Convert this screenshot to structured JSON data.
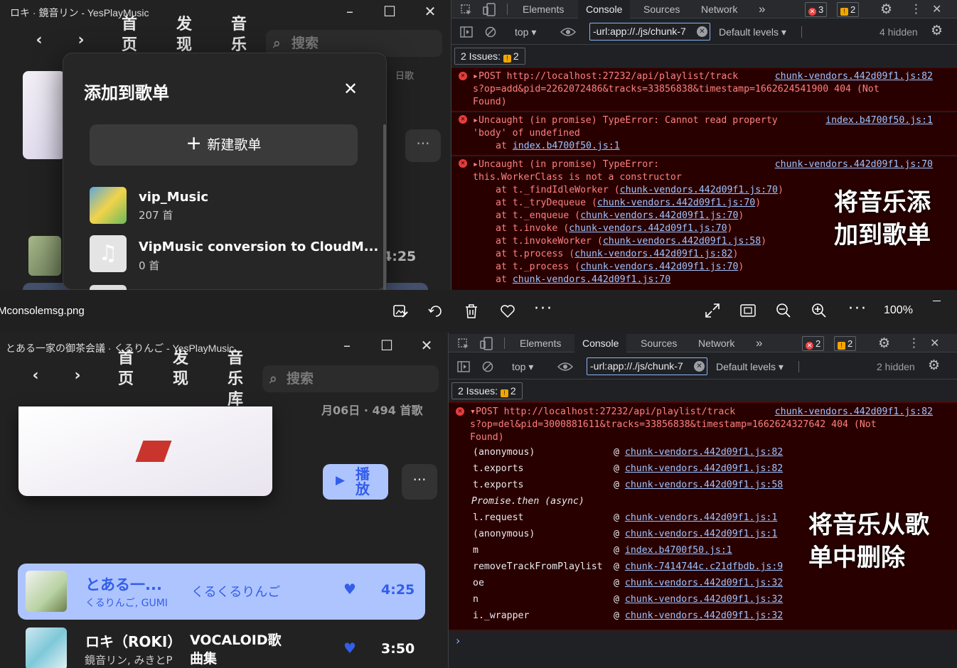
{
  "top_app": {
    "window_title": "ロキ · 鏡音リン - YesPlayMusic",
    "nav": {
      "back": "‹",
      "forward": "›"
    },
    "nav_items": [
      {
        "label": "首页"
      },
      {
        "label": "发现"
      },
      {
        "label": "音乐"
      }
    ],
    "search_placeholder": "搜索",
    "playlist_meta": "日歌",
    "track_time": "4:25",
    "dialog": {
      "title": "添加到歌单",
      "new_playlist_label": "新建歌单",
      "items": [
        {
          "name": "vip_Music",
          "count": "207 首"
        },
        {
          "name": "VipMusic conversion to CloudM...",
          "count": "0 首"
        }
      ]
    }
  },
  "top_devtools": {
    "tabs": [
      "Elements",
      "Console",
      "Sources",
      "Network"
    ],
    "active_tab": "Console",
    "error_count": "3",
    "warning_count": "2",
    "context": "top",
    "filter_text": "-url:app://./js/chunk-7",
    "levels": "Default levels",
    "hidden": "4 hidden",
    "issues_label": "2 Issues:",
    "issues_count": "2",
    "errors": [
      {
        "lines": [
          "POST http://localhost:27232/api/playlist/track",
          "s?op=add&pid=2262072486&tracks=33856838&timestamp=1662624541900 404 (Not",
          "Found)"
        ],
        "source": "chunk-vendors.442d09f1.js:82"
      },
      {
        "lines": [
          "Uncaught (in promise) TypeError: Cannot read property",
          "'body' of undefined"
        ],
        "at": "index.b4700f50.js:1",
        "source": "index.b4700f50.js:1"
      },
      {
        "lines": [
          "Uncaught (in promise) TypeError:",
          "this.WorkerClass is not a constructor"
        ],
        "source": "chunk-vendors.442d09f1.js:70",
        "stack": [
          {
            "fn": "t._findIdleWorker",
            "loc": "chunk-vendors.442d09f1.js:70"
          },
          {
            "fn": "t._tryDequeue",
            "loc": "chunk-vendors.442d09f1.js:70"
          },
          {
            "fn": "t._enqueue",
            "loc": "chunk-vendors.442d09f1.js:70"
          },
          {
            "fn": "t.invoke",
            "loc": "chunk-vendors.442d09f1.js:70"
          },
          {
            "fn": "t.invokeWorker",
            "loc": "chunk-vendors.442d09f1.js:58"
          },
          {
            "fn": "t.process",
            "loc": "chunk-vendors.442d09f1.js:82"
          },
          {
            "fn": "t._process",
            "loc": "chunk-vendors.442d09f1.js:70"
          },
          {
            "fn": "",
            "loc": "chunk-vendors.442d09f1.js:70"
          }
        ]
      }
    ],
    "annotation_lines": [
      "将音乐添",
      "加到歌单"
    ]
  },
  "viewer": {
    "filename": "Mconsolemsg.png",
    "zoom": "100%"
  },
  "bottom_app": {
    "window_title": "とある一家の御茶会議 · くるりんご - YesPlayMusic",
    "nav_items": [
      {
        "label": "首页"
      },
      {
        "label": "发现"
      },
      {
        "label": "音乐库"
      }
    ],
    "search_placeholder": "搜索",
    "playlist_meta": "月06日 · 494 首歌",
    "play_label": "播放",
    "tracks": [
      {
        "title": "とある一...",
        "artists": "くるりんご, GUMI",
        "album": "くるくるりんご",
        "duration": "4:25",
        "active": true
      },
      {
        "title": "ロキ（ROKI）",
        "artists": "鏡音リン, みきとP",
        "album": "VOCALOID歌曲集",
        "duration": "3:50",
        "active": false
      }
    ]
  },
  "bottom_devtools": {
    "tabs": [
      "Elements",
      "Console",
      "Sources",
      "Network"
    ],
    "active_tab": "Console",
    "error_count": "2",
    "warning_count": "2",
    "context": "top",
    "filter_text": "-url:app://./js/chunk-7",
    "levels": "Default levels",
    "hidden": "2 hidden",
    "issues_label": "2 Issues:",
    "issues_count": "2",
    "error": {
      "lines": [
        "POST http://localhost:27232/api/playlist/track",
        "s?op=del&pid=3000881611&tracks=33856838&timestamp=1662624327642 404 (Not",
        "Found)"
      ],
      "source": "chunk-vendors.442d09f1.js:82"
    },
    "stack": [
      {
        "fn": "(anonymous)",
        "loc": "chunk-vendors.442d09f1.js:82"
      },
      {
        "fn": "t.exports",
        "loc": "chunk-vendors.442d09f1.js:82"
      },
      {
        "fn": "t.exports",
        "loc": "chunk-vendors.442d09f1.js:58"
      },
      {
        "fn": "Promise.then (async)",
        "loc": ""
      },
      {
        "fn": "l.request",
        "loc": "chunk-vendors.442d09f1.js:1"
      },
      {
        "fn": "(anonymous)",
        "loc": "chunk-vendors.442d09f1.js:1"
      },
      {
        "fn": "m",
        "loc": "index.b4700f50.js:1"
      },
      {
        "fn": "removeTrackFromPlaylist",
        "loc": "chunk-7414744c.c21dfbdb.js:9"
      },
      {
        "fn": "oe",
        "loc": "chunk-vendors.442d09f1.js:32"
      },
      {
        "fn": "n",
        "loc": "chunk-vendors.442d09f1.js:32"
      },
      {
        "fn": "i._wrapper",
        "loc": "chunk-vendors.442d09f1.js:32"
      }
    ],
    "annotation_lines": [
      "将音乐从歌",
      "单中删除"
    ]
  },
  "colors": {
    "accent": "#335eea",
    "accent_light": "#aec4ff",
    "error_bg": "#290000"
  }
}
